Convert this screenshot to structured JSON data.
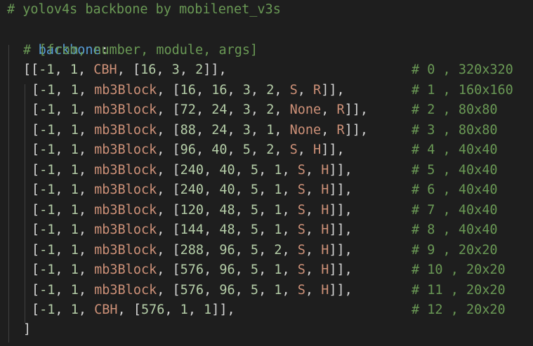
{
  "editor": {
    "header_comment": "# yolov4s backbone by mobilenet_v3s",
    "key": "backbone",
    "colon": ":",
    "fields_comment": "# [from, number, module, args]",
    "open_bracket": "[",
    "close_bracket": "]",
    "rows": [
      {
        "from": "-1",
        "number": "1",
        "module": "CBH",
        "args": [
          "16",
          "3",
          "2"
        ],
        "comment": "# 0 , 320x320"
      },
      {
        "from": "-1",
        "number": "1",
        "module": "mb3Block",
        "args": [
          "16",
          "16",
          "3",
          "2",
          "S",
          "R"
        ],
        "comment": "# 1 , 160x160"
      },
      {
        "from": "-1",
        "number": "1",
        "module": "mb3Block",
        "args": [
          "72",
          "24",
          "3",
          "2",
          "None",
          "R"
        ],
        "comment": "# 2 , 80x80"
      },
      {
        "from": "-1",
        "number": "1",
        "module": "mb3Block",
        "args": [
          "88",
          "24",
          "3",
          "1",
          "None",
          "R"
        ],
        "comment": "# 3 , 80x80"
      },
      {
        "from": "-1",
        "number": "1",
        "module": "mb3Block",
        "args": [
          "96",
          "40",
          "5",
          "2",
          "S",
          "H"
        ],
        "comment": "# 4 , 40x40"
      },
      {
        "from": "-1",
        "number": "1",
        "module": "mb3Block",
        "args": [
          "240",
          "40",
          "5",
          "1",
          "S",
          "H"
        ],
        "comment": "# 5 , 40x40"
      },
      {
        "from": "-1",
        "number": "1",
        "module": "mb3Block",
        "args": [
          "240",
          "40",
          "5",
          "1",
          "S",
          "H"
        ],
        "comment": "# 6 , 40x40"
      },
      {
        "from": "-1",
        "number": "1",
        "module": "mb3Block",
        "args": [
          "120",
          "48",
          "5",
          "1",
          "S",
          "H"
        ],
        "comment": "# 7 , 40x40"
      },
      {
        "from": "-1",
        "number": "1",
        "module": "mb3Block",
        "args": [
          "144",
          "48",
          "5",
          "1",
          "S",
          "H"
        ],
        "comment": "# 8 , 40x40"
      },
      {
        "from": "-1",
        "number": "1",
        "module": "mb3Block",
        "args": [
          "288",
          "96",
          "5",
          "2",
          "S",
          "H"
        ],
        "comment": "# 9 , 20x20"
      },
      {
        "from": "-1",
        "number": "1",
        "module": "mb3Block",
        "args": [
          "576",
          "96",
          "5",
          "1",
          "S",
          "H"
        ],
        "comment": "# 10 , 20x20"
      },
      {
        "from": "-1",
        "number": "1",
        "module": "mb3Block",
        "args": [
          "576",
          "96",
          "5",
          "1",
          "S",
          "H"
        ],
        "comment": "# 11 , 20x20"
      },
      {
        "from": "-1",
        "number": "1",
        "module": "CBH",
        "args": [
          "576",
          "1",
          "1"
        ],
        "comment": "# 12 , 20x20"
      }
    ]
  },
  "colors": {
    "background": "#1e1e1e",
    "comment": "#6a9955",
    "key": "#569cd6",
    "number": "#b5cea8",
    "string": "#ce9178",
    "punctuation": "#d4d4d4"
  }
}
